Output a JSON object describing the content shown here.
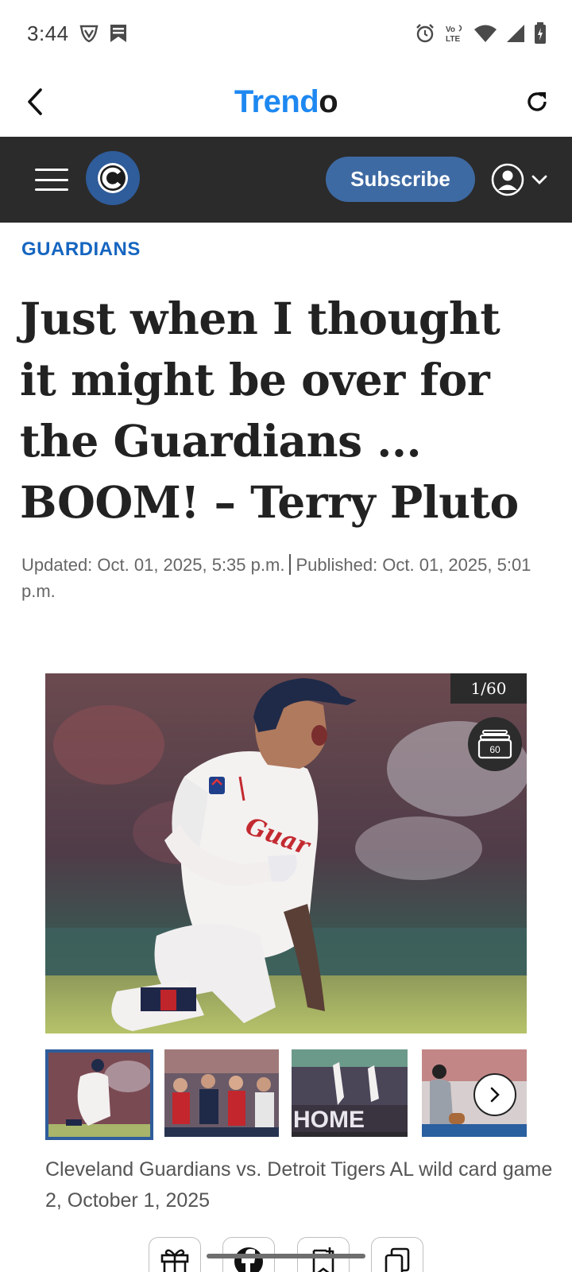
{
  "status_bar": {
    "time": "3:44",
    "network_label": "Vo LTE"
  },
  "app_header": {
    "title_part1": "Trend",
    "title_part2": "o"
  },
  "site_nav": {
    "subscribe_label": "Subscribe"
  },
  "article": {
    "category": "GUARDIANS",
    "headline": "Just when I thought it might be over for the Guardians ... BOOM! – Terry Pluto",
    "updated": "Updated: Oct. 01, 2025, 5:35 p.m.",
    "published": "Published: Oct. 01, 2025, 5:01 p.m."
  },
  "gallery": {
    "counter": "1/60",
    "photo_count": "60",
    "caption": "Cleveland Guardians vs. Detroit Tigers AL wild card game 2, October 1, 2025",
    "thumbnail_text": "HOME"
  },
  "colors": {
    "accent_blue": "#1e88f0",
    "nav_background": "#2b2b2b",
    "subscribe_blue": "#3e6aa3",
    "category_blue": "#1565c0"
  },
  "icons": {
    "back": "chevron-left-icon",
    "reload": "reload-icon",
    "menu": "hamburger-menu-icon",
    "account": "user-circle-icon",
    "gallery": "stack-icon",
    "share": [
      "gift-icon",
      "facebook-icon",
      "bookmark-icon",
      "copy-icon"
    ]
  }
}
